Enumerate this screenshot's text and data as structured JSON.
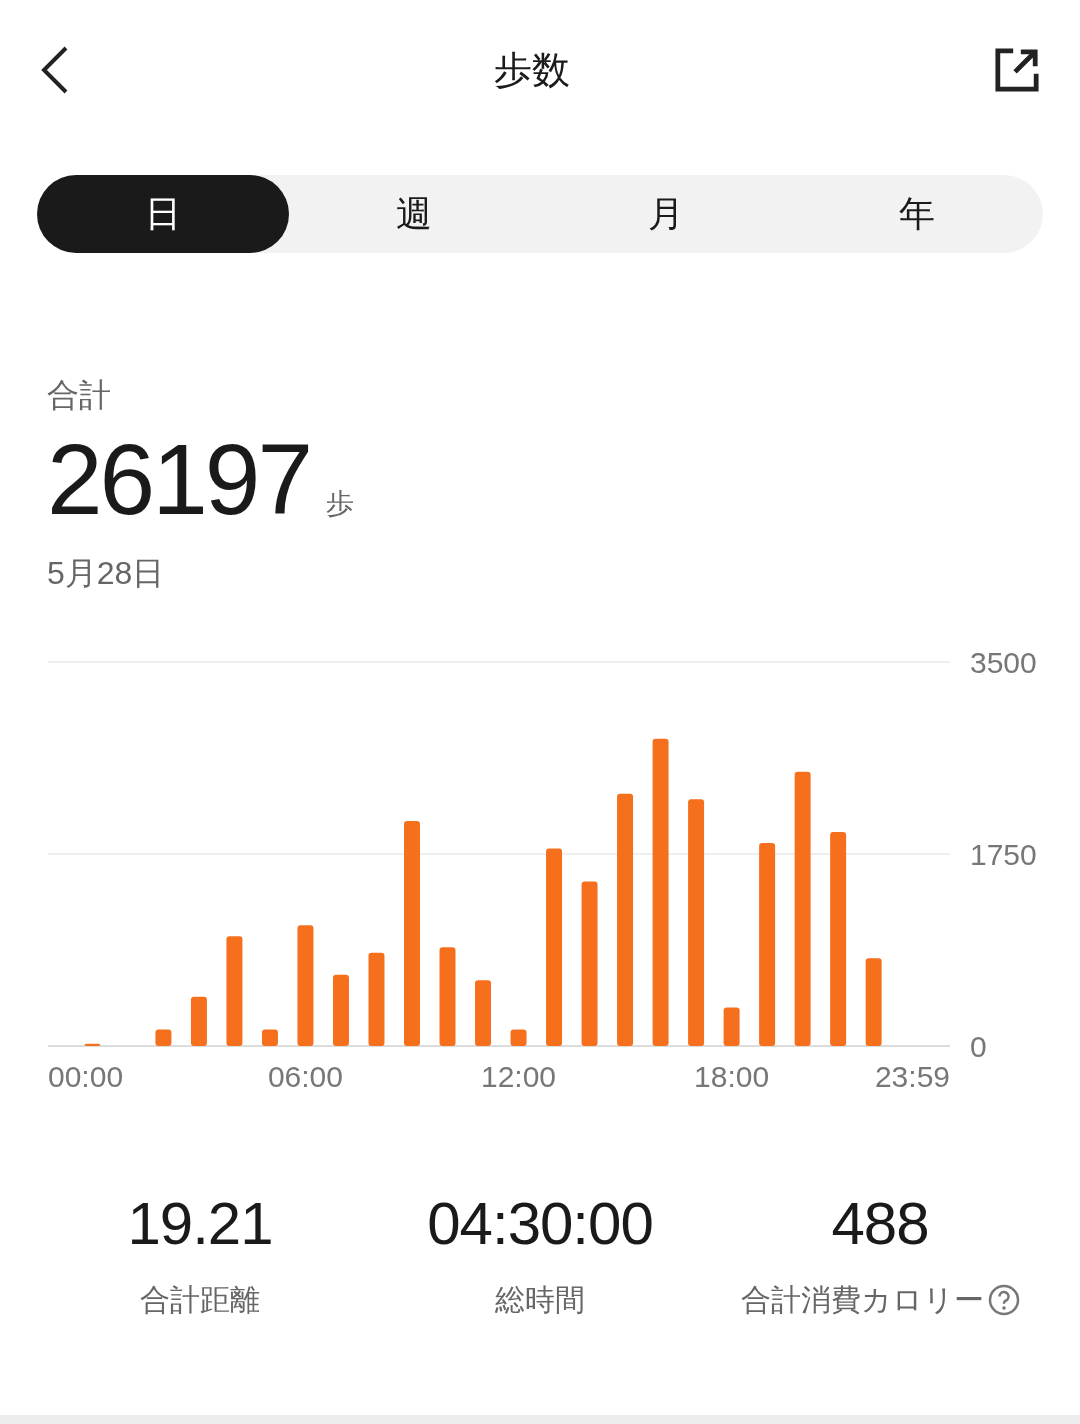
{
  "header": {
    "title": "歩数"
  },
  "tabs": [
    {
      "label": "日",
      "selected": true
    },
    {
      "label": "週",
      "selected": false
    },
    {
      "label": "月",
      "selected": false
    },
    {
      "label": "年",
      "selected": false
    }
  ],
  "summary": {
    "label": "合計",
    "value": "26197",
    "unit": "歩",
    "date": "5月28日"
  },
  "chart_data": {
    "type": "bar",
    "color": "#f56f1c",
    "x": [
      0,
      1,
      2,
      3,
      4,
      5,
      6,
      7,
      8,
      9,
      10,
      11,
      12,
      13,
      14,
      15,
      16,
      17,
      18,
      19,
      20,
      21,
      22,
      23
    ],
    "values": [
      20,
      0,
      150,
      450,
      1000,
      150,
      1100,
      650,
      850,
      2050,
      900,
      600,
      150,
      1800,
      1500,
      2300,
      2800,
      2250,
      350,
      1850,
      2500,
      1950,
      800,
      0
    ],
    "xticks": [
      {
        "value": 0,
        "label": "00:00"
      },
      {
        "value": 6,
        "label": "06:00"
      },
      {
        "value": 12,
        "label": "12:00"
      },
      {
        "value": 18,
        "label": "18:00"
      },
      {
        "value": 23.98,
        "label": "23:59"
      }
    ],
    "xlim": [
      -1.25,
      24.15
    ],
    "ylim": [
      0,
      3500
    ],
    "yticks": [
      0,
      1750,
      3500
    ]
  },
  "stats": [
    {
      "value": "19.21",
      "label": "合計距離",
      "help": false
    },
    {
      "value": "04:30:00",
      "label": "総時間",
      "help": false
    },
    {
      "value": "488",
      "label": "合計消費カロリー",
      "help": true
    }
  ]
}
